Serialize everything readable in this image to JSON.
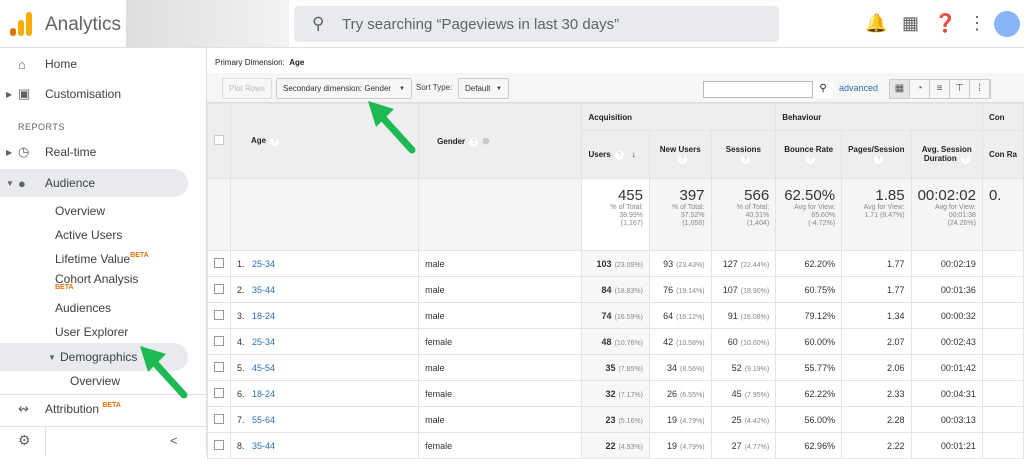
{
  "header": {
    "app_title": "Analytics",
    "search_placeholder": "Try searching “Pageviews in last 30 days”"
  },
  "sidebar": {
    "home": "Home",
    "customisation": "Customisation",
    "reports_label": "REPORTS",
    "realtime": "Real-time",
    "audience": "Audience",
    "audience_items": [
      "Overview",
      "Active Users",
      "Lifetime Value",
      "Cohort Analysis",
      "Audiences",
      "User Explorer"
    ],
    "beta": "BETA",
    "demographics": "Demographics",
    "demographics_overview": "Overview",
    "attribution": "Attribution",
    "collapse": "<"
  },
  "report": {
    "primary_dimension_label": "Primary Dimension:",
    "primary_dimension": "Age",
    "plot_rows": "Plot Rows",
    "secondary_dimension": "Secondary dimension: Gender",
    "sort_type_label": "Sort Type:",
    "sort_type": "Default",
    "advanced": "advanced",
    "groups": {
      "acquisition": "Acquisition",
      "behaviour": "Behaviour",
      "conversions": "Con"
    },
    "columns": {
      "age": "Age",
      "gender": "Gender",
      "users": "Users",
      "new_users": "New Users",
      "sessions": "Sessions",
      "bounce_rate": "Bounce Rate",
      "pages_session": "Pages/Session",
      "avg_duration": "Avg. Session Duration",
      "conv": "Con Ra"
    },
    "totals": {
      "users": {
        "value": "455",
        "l1": "% of Total:",
        "l2": "38.99%",
        "l3": "(1,167)"
      },
      "new_users": {
        "value": "397",
        "l1": "% of Total:",
        "l2": "37.52%",
        "l3": "(1,058)"
      },
      "sessions": {
        "value": "566",
        "l1": "% of Total:",
        "l2": "40.31%",
        "l3": "(1,404)"
      },
      "bounce_rate": {
        "value": "62.50%",
        "l1": "Avg for View:",
        "l2": "65.60%",
        "l3": "(-4.72%)"
      },
      "pages_session": {
        "value": "1.85",
        "l1": "Avg for View:",
        "l2": "1.71 (8.47%)",
        "l3": ""
      },
      "avg_duration": {
        "value": "00:02:02",
        "l1": "Avg for View:",
        "l2": "00:01:38",
        "l3": "(24.26%)"
      },
      "conv": {
        "value": "0."
      }
    },
    "rows": [
      {
        "n": "1.",
        "age": "25-34",
        "gender": "male",
        "users": "103",
        "users_pct": "(23.09%)",
        "new": "93",
        "new_pct": "(23.43%)",
        "sess": "127",
        "sess_pct": "(22.44%)",
        "bounce": "62.20%",
        "pps": "1.77",
        "dur": "00:02:19"
      },
      {
        "n": "2.",
        "age": "35-44",
        "gender": "male",
        "users": "84",
        "users_pct": "(18.83%)",
        "new": "76",
        "new_pct": "(19.14%)",
        "sess": "107",
        "sess_pct": "(18.90%)",
        "bounce": "60.75%",
        "pps": "1.77",
        "dur": "00:01:36"
      },
      {
        "n": "3.",
        "age": "18-24",
        "gender": "male",
        "users": "74",
        "users_pct": "(16.59%)",
        "new": "64",
        "new_pct": "(16.12%)",
        "sess": "91",
        "sess_pct": "(16.08%)",
        "bounce": "79.12%",
        "pps": "1.34",
        "dur": "00:00:32"
      },
      {
        "n": "4.",
        "age": "25-34",
        "gender": "female",
        "users": "48",
        "users_pct": "(10.76%)",
        "new": "42",
        "new_pct": "(10.58%)",
        "sess": "60",
        "sess_pct": "(10.60%)",
        "bounce": "60.00%",
        "pps": "2.07",
        "dur": "00:02:43"
      },
      {
        "n": "5.",
        "age": "45-54",
        "gender": "male",
        "users": "35",
        "users_pct": "(7.85%)",
        "new": "34",
        "new_pct": "(8.56%)",
        "sess": "52",
        "sess_pct": "(9.19%)",
        "bounce": "55.77%",
        "pps": "2.06",
        "dur": "00:01:42"
      },
      {
        "n": "6.",
        "age": "18-24",
        "gender": "female",
        "users": "32",
        "users_pct": "(7.17%)",
        "new": "26",
        "new_pct": "(6.55%)",
        "sess": "45",
        "sess_pct": "(7.95%)",
        "bounce": "62.22%",
        "pps": "2.33",
        "dur": "00:04:31"
      },
      {
        "n": "7.",
        "age": "55-64",
        "gender": "male",
        "users": "23",
        "users_pct": "(5.16%)",
        "new": "19",
        "new_pct": "(4.79%)",
        "sess": "25",
        "sess_pct": "(4.42%)",
        "bounce": "56.00%",
        "pps": "2.28",
        "dur": "00:03:13"
      },
      {
        "n": "8.",
        "age": "35-44",
        "gender": "female",
        "users": "22",
        "users_pct": "(4.93%)",
        "new": "19",
        "new_pct": "(4.79%)",
        "sess": "27",
        "sess_pct": "(4.77%)",
        "bounce": "62.96%",
        "pps": "2.22",
        "dur": "00:01:21"
      }
    ]
  },
  "colors": {
    "arrow": "#1db954",
    "accent": "#f9ab00",
    "link": "#2a6ebb"
  }
}
